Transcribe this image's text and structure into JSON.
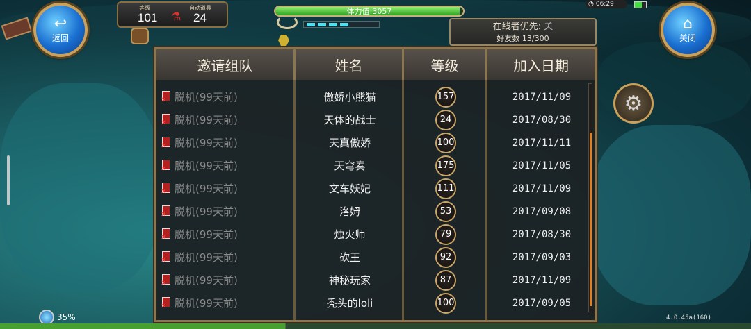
{
  "nav": {
    "back_label": "返回",
    "close_label": "关闭"
  },
  "player": {
    "level_label": "等级",
    "level": "101",
    "auto_item_label": "自动道具",
    "auto_item_count": "24"
  },
  "stamina": {
    "text": "体力值:3057",
    "fill_fraction": 0.98
  },
  "system": {
    "time": "06:29"
  },
  "online": {
    "priority_label": "在线者优先:",
    "priority_value": "关",
    "friends_text": "好友数 13/300"
  },
  "table": {
    "headers": [
      "邀请组队",
      "姓名",
      "等级",
      "加入日期"
    ],
    "rows": [
      {
        "status": "脱机(99天前)",
        "name": "傲娇小熊猫",
        "level": "157",
        "date": "2017/11/09"
      },
      {
        "status": "脱机(99天前)",
        "name": "天体的战士",
        "level": "24",
        "date": "2017/08/30"
      },
      {
        "status": "脱机(99天前)",
        "name": "天真傲娇",
        "level": "100",
        "date": "2017/11/11"
      },
      {
        "status": "脱机(99天前)",
        "name": "天穹奏",
        "level": "175",
        "date": "2017/11/05"
      },
      {
        "status": "脱机(99天前)",
        "name": "文车妖妃",
        "level": "111",
        "date": "2017/11/09"
      },
      {
        "status": "脱机(99天前)",
        "name": "洛姆",
        "level": "53",
        "date": "2017/09/08"
      },
      {
        "status": "脱机(99天前)",
        "name": "烛火师",
        "level": "79",
        "date": "2017/08/30"
      },
      {
        "status": "脱机(99天前)",
        "name": "砍王",
        "level": "92",
        "date": "2017/09/03"
      },
      {
        "status": "脱机(99天前)",
        "name": "神秘玩家",
        "level": "87",
        "date": "2017/11/09"
      },
      {
        "status": "脱机(99天前)",
        "name": "秃头的loli",
        "level": "100",
        "date": "2017/09/05"
      }
    ]
  },
  "footer": {
    "progress": "35%",
    "version": "4.0.45a(160)"
  },
  "icons": {
    "back": "back-arrow-icon",
    "close": "home-icon",
    "settings": "gear-icon",
    "offline": "offline-doc-icon"
  }
}
